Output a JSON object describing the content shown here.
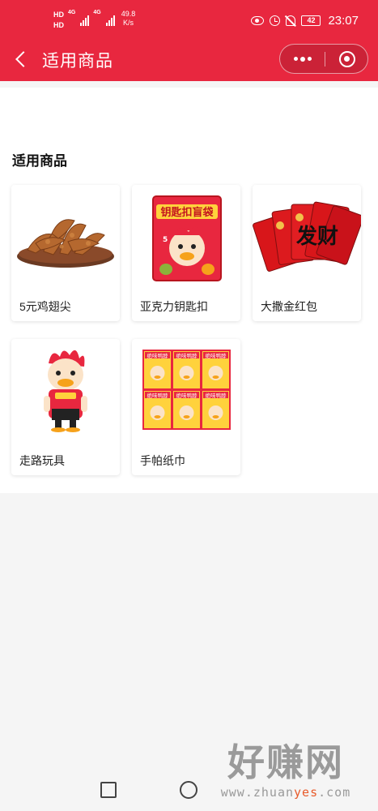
{
  "status_bar": {
    "hd1": "HD",
    "hd2": "HD",
    "net1": "4G",
    "net2": "4G",
    "speed": "49.8",
    "speed_unit": "K/s",
    "battery": "42",
    "time": "23:07"
  },
  "nav": {
    "title": "适用商品"
  },
  "section": {
    "title": "适用商品"
  },
  "products": [
    {
      "name": "5元鸡翅尖",
      "icon": "chicken-wing-tips-image"
    },
    {
      "name": "亚克力钥匙扣",
      "icon": "keychain-blind-bag-image",
      "image_text": "钥匙扣盲袋"
    },
    {
      "name": "大撒金红包",
      "icon": "red-envelopes-image",
      "image_text": "发财"
    },
    {
      "name": "走路玩具",
      "icon": "walking-duck-toy-image"
    },
    {
      "name": "手帕纸巾",
      "icon": "tissue-packs-image",
      "image_text": "绝味鸭脖"
    }
  ],
  "watermark": {
    "cn": "好赚网",
    "en_prefix": "www.zhuan",
    "en_highlight": "yes",
    "en_suffix": ".com"
  },
  "colors": {
    "header_bg": "#e8273f",
    "page_bg": "#f5f5f5",
    "card_bg": "#ffffff"
  }
}
